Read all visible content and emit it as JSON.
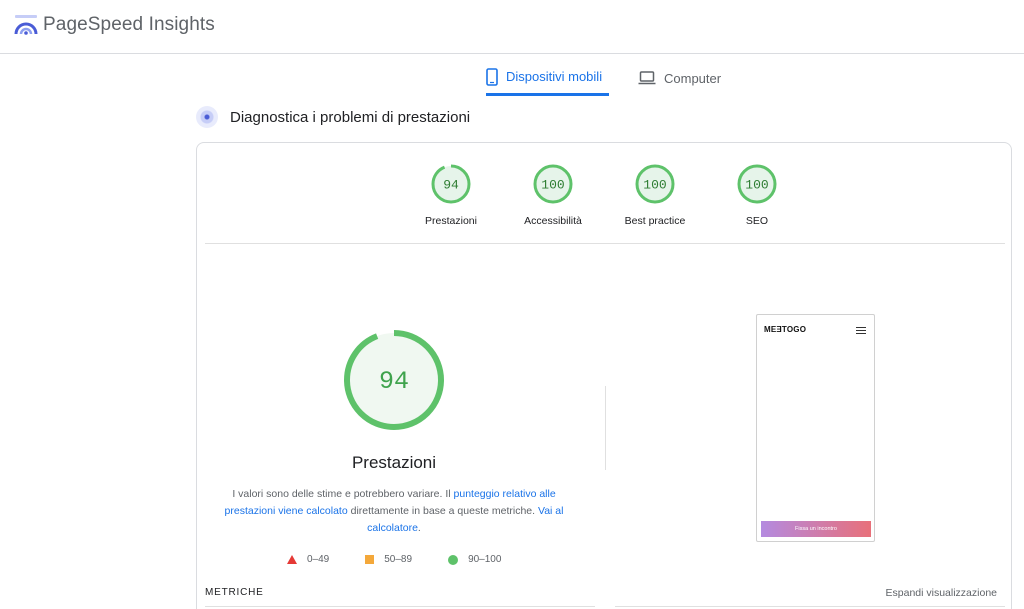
{
  "header": {
    "title": "PageSpeed Insights",
    "logo_icon": "pagespeed-logo-icon"
  },
  "tabs": [
    {
      "label": "Dispositivi mobili",
      "icon": "smartphone-icon",
      "active": true
    },
    {
      "label": "Computer",
      "icon": "laptop-icon",
      "active": false
    }
  ],
  "diagnostics": {
    "title": "Diagnostica i problemi di prestazioni",
    "icon": "diagnostics-icon"
  },
  "scores": [
    {
      "value": "94",
      "label": "Prestazioni",
      "fraction": 0.94
    },
    {
      "value": "100",
      "label": "Accessibilità",
      "fraction": 1.0
    },
    {
      "value": "100",
      "label": "Best practice",
      "fraction": 1.0
    },
    {
      "value": "100",
      "label": "SEO",
      "fraction": 1.0
    }
  ],
  "performance": {
    "score": "94",
    "fraction": 0.94,
    "label": "Prestazioni",
    "desc_1": "I valori sono delle stime e potrebbero variare. Il ",
    "link_1": "punteggio relativo alle prestazioni viene calcolato",
    "desc_2": " direttamente in base a queste metriche. ",
    "link_2": "Vai al calcolatore",
    "desc_3": "."
  },
  "legend": [
    {
      "range": "0–49",
      "shape": "triangle",
      "color": "#e53935"
    },
    {
      "range": "50–89",
      "shape": "square",
      "color": "#f4a83a"
    },
    {
      "range": "90–100",
      "shape": "circle",
      "color": "#5ec26a"
    }
  ],
  "screenshot": {
    "site_logo": "MEƎTOGO",
    "cta": "Fissa un incontro"
  },
  "metrics": {
    "heading": "METRICHE",
    "expand": "Espandi visualizzazione"
  },
  "colors": {
    "accent": "#1a73e8",
    "pass": "#0cce6b",
    "pass_text": "#008800",
    "pass_fill": "#e6f4ea"
  }
}
